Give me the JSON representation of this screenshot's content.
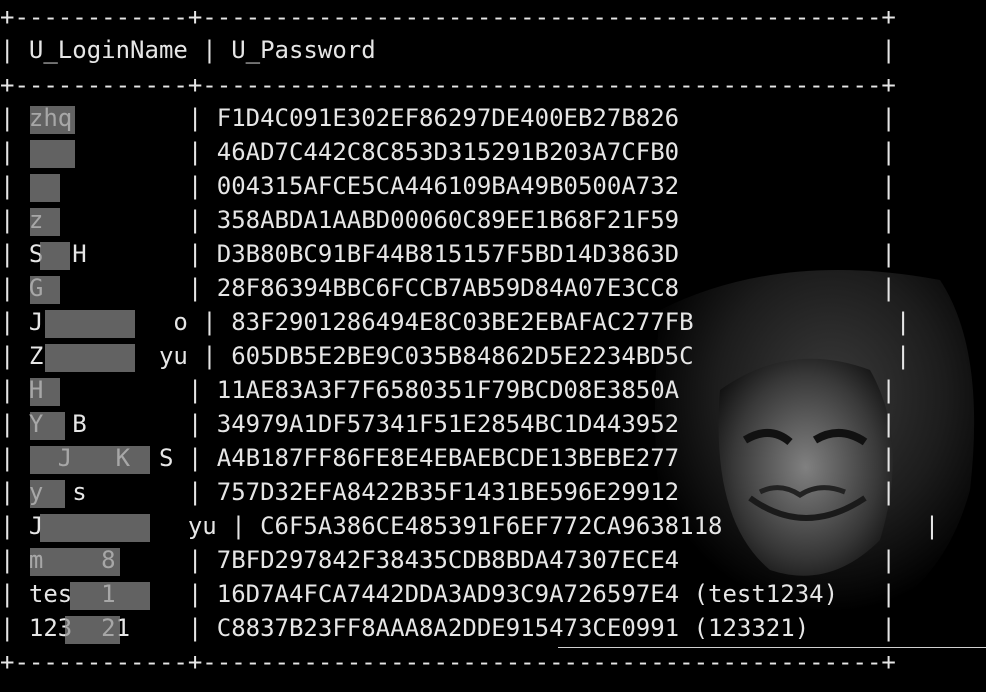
{
  "table": {
    "border_line": "+------------+-----------------------------------------------+",
    "header_row": "| U_LoginName | U_Password                                   |",
    "headers": [
      "U_LoginName",
      "U_Password"
    ],
    "rows": [
      {
        "login": "zhq",
        "password": "F1D4C091E302EF86297DE400EB27B826"
      },
      {
        "login": "",
        "password": "46AD7C442C8C853D315291B203A7CFB0"
      },
      {
        "login": "",
        "password": "004315AFCE5CA446109BA49B0500A732"
      },
      {
        "login": "z",
        "password": "358ABDA1AABD00060C89EE1B68F21F59"
      },
      {
        "login": "S  H",
        "password": "D3B80BC91BF44B815157F5BD14D3863D"
      },
      {
        "login": "G",
        "password": "28F86394BBC6FCCB7AB59D84A07E3CC8"
      },
      {
        "login": "J         o",
        "password": "83F2901286494E8C03BE2EBAFAC277FB"
      },
      {
        "login": "Z        yu",
        "password": "605DB5E2BE9C035B84862D5E2234BD5C"
      },
      {
        "login": "H",
        "password": "11AE83A3F7F6580351F79BCD08E3850A"
      },
      {
        "login": "Y  B",
        "password": "34979A1DF57341F51E2854BC1D443952"
      },
      {
        "login": "  J   K  S",
        "password": "A4B187FF86FE8E4EBAEBCDE13BEBE277"
      },
      {
        "login": "y  s",
        "password": "757D32EFA8422B35F1431BE596E29912"
      },
      {
        "login": "J          yu",
        "password": "C6F5A386CE485391F6EF772CA9638118"
      },
      {
        "login": "m    8",
        "password": "7BFD297842F38435CDB8BDA47307ECE4"
      },
      {
        "login": "tes  1",
        "password": "16D7A4FCA7442DDA3AD93C9A726597E4 (test1234)"
      },
      {
        "login": "123  21",
        "password": "C8837B23FF8AAA8A2DDE915473CE0991 (123321)"
      }
    ]
  }
}
